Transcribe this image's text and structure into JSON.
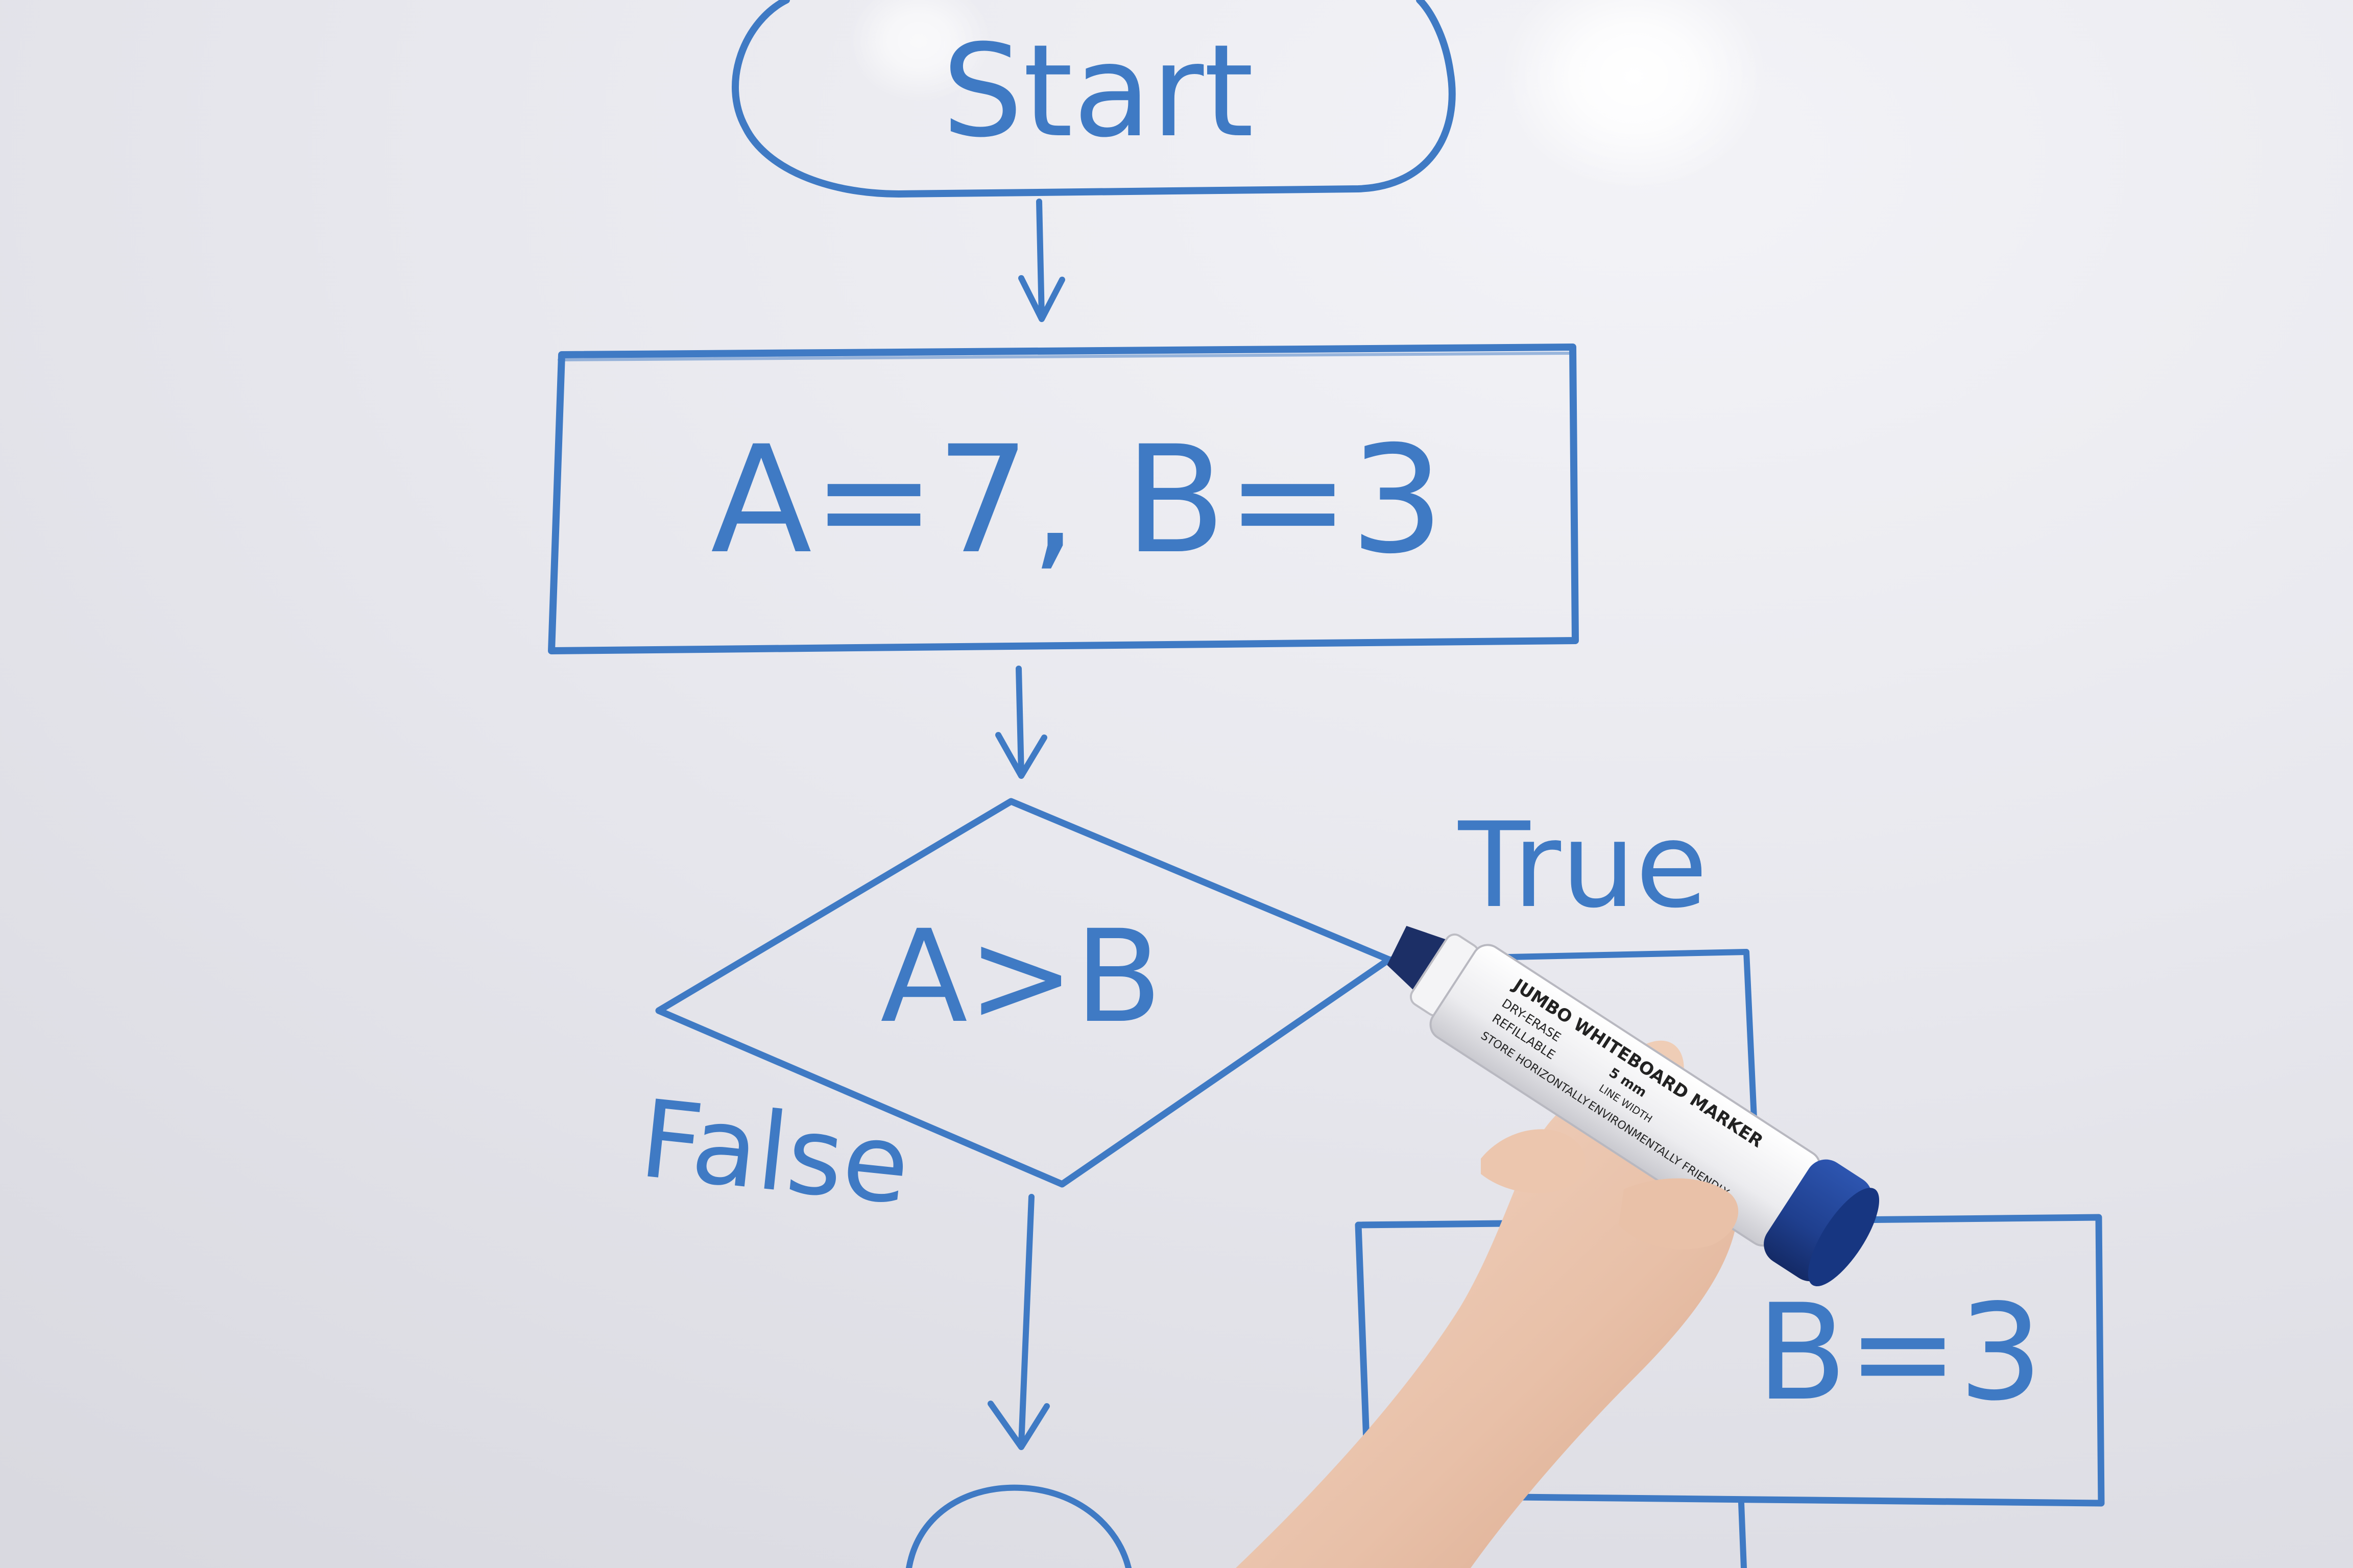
{
  "whiteboard": {
    "ink_color": "#3f7ac4",
    "board_color": "#e6e6ec"
  },
  "flowchart": {
    "start_label": "Start",
    "assign_label": "A=7, B=3",
    "decision_label": "A>B",
    "true_label": "True",
    "false_label": "False",
    "true_box_label": "B=3"
  },
  "marker": {
    "cap_color": "#1f3f8e",
    "barrel_color": "#f2f2f4",
    "label_line_1": "JUMBO WHITEBOARD MARKER",
    "label_line_2": "DRY-ERASE",
    "label_line_3": "REFILLABLE",
    "label_line_4": "5 mm",
    "label_line_5": "LINE WIDTH",
    "label_line_6": "ENVIRONMENTALLY FRIENDLY",
    "label_line_7": "STORE HORIZONTALLY"
  }
}
